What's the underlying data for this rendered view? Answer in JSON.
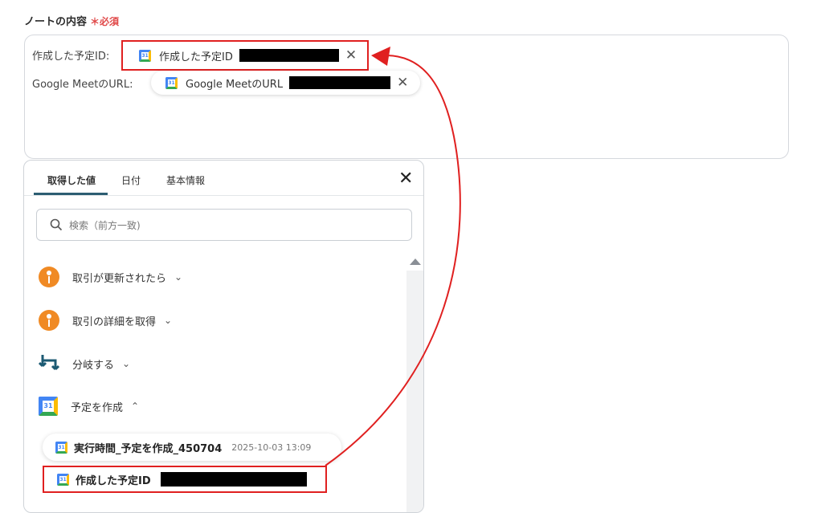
{
  "field": {
    "label": "ノートの内容",
    "required": "＊必須"
  },
  "note": {
    "line1_label": "作成した予定ID:",
    "line1_chip": "作成した予定ID",
    "line2_label": "Google MeetのURL:",
    "line2_chip": "Google MeetのURL"
  },
  "panel": {
    "tabs": [
      "取得した値",
      "日付",
      "基本情報"
    ],
    "search_placeholder": "検索（前方一致)",
    "items": [
      {
        "label": "取引が更新されたら",
        "icon": "hubspot-icon",
        "expanded": false
      },
      {
        "label": "取引の詳細を取得",
        "icon": "hubspot-icon",
        "expanded": false
      },
      {
        "label": "分岐する",
        "icon": "branch-icon",
        "expanded": false
      },
      {
        "label": "予定を作成",
        "icon": "google-calendar-icon",
        "expanded": true
      }
    ],
    "sub_items": [
      {
        "label": "実行時間_予定を作成_450704",
        "timestamp": "2025-10-03 13:09"
      },
      {
        "label": "作成した予定ID"
      }
    ]
  },
  "colors": {
    "accent": "#2c5d72",
    "highlight": "#e02020",
    "required": "#e04848"
  }
}
